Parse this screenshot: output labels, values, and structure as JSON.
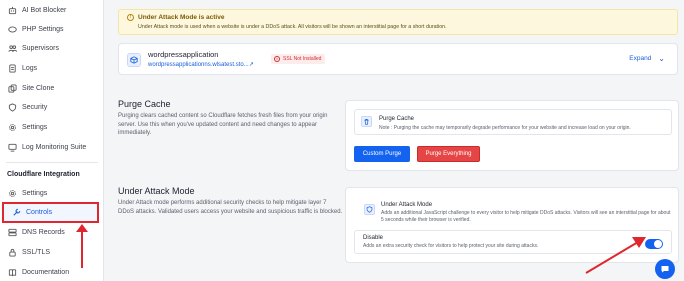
{
  "sidebar": {
    "items": [
      {
        "label": "AI Bot Blocker",
        "icon": "robot-icon"
      },
      {
        "label": "PHP Settings",
        "icon": "php-icon"
      },
      {
        "label": "Supervisors",
        "icon": "users-icon"
      },
      {
        "label": "Logs",
        "icon": "document-icon"
      },
      {
        "label": "Site Clone",
        "icon": "copy-icon"
      },
      {
        "label": "Security",
        "icon": "shield-icon"
      },
      {
        "label": "Settings",
        "icon": "gear-icon"
      },
      {
        "label": "Log Monitoring Suite",
        "icon": "monitor-icon"
      }
    ],
    "section_title": "Cloudflare Integration",
    "cf_items": [
      {
        "label": "Settings",
        "icon": "gear-icon"
      },
      {
        "label": "Controls",
        "icon": "wrench-icon"
      },
      {
        "label": "DNS Records",
        "icon": "server-icon"
      },
      {
        "label": "SSL/TLS",
        "icon": "lock-icon"
      },
      {
        "label": "Documentation",
        "icon": "book-icon"
      }
    ]
  },
  "alert": {
    "title": "Under Attack Mode is active",
    "text": "Under Attack mode is used when a website is under a DDoS attack. All visitors will be shown an interstitial page for a short duration."
  },
  "app": {
    "name": "wordpressapplication",
    "url": "wordpressapplicationns.wlsatest.sto...↗",
    "ssl_badge": "SSL Not Installed",
    "expand_label": "Expand",
    "expand_icon": "chevron-down-icon"
  },
  "purge": {
    "title": "Purge Cache",
    "description": "Purging clears cached content so Cloudflare fetches fresh files from your origin server. Use this when you've updated content and need changes to appear immediately.",
    "card_title": "Purge Cache",
    "card_note": "Note : Purging the cache may temporarily degrade performance for your website and increase load on your origin.",
    "custom_label": "Custom Purge",
    "everything_label": "Purge Everything"
  },
  "attack": {
    "title": "Under Attack Mode",
    "description": "Under Attack mode performs additional security checks to help mitigate layer 7 DDoS attacks. Validated users access your website and suspicious traffic is blocked.",
    "card_title": "Under Attack Mode",
    "card_desc": "Adds an additional JavaScript challenge to every visitor to help mitigate DDoS attacks. Visitors will see an interstitial page for about 5 seconds while their browser is verified.",
    "disable_title": "Disable",
    "disable_desc": "Adds an extra security check for visitors to help protect your site during attacks.",
    "toggle_on": true
  },
  "colors": {
    "accent": "#1463f0",
    "danger": "#e64545",
    "annotation": "#e0262e"
  }
}
